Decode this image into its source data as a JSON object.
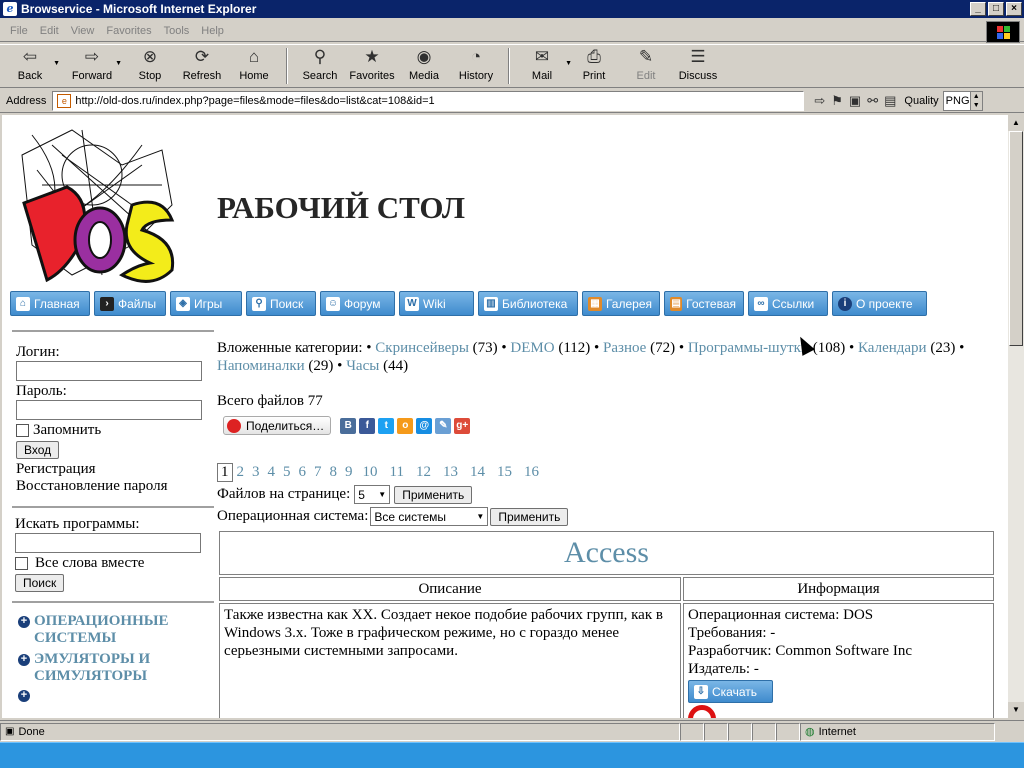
{
  "window": {
    "title": "Browservice - Microsoft Internet Explorer"
  },
  "menu": [
    "File",
    "Edit",
    "View",
    "Favorites",
    "Tools",
    "Help"
  ],
  "toolbar": {
    "back": "Back",
    "forward": "Forward",
    "stop": "Stop",
    "refresh": "Refresh",
    "home": "Home",
    "search": "Search",
    "favorites": "Favorites",
    "media": "Media",
    "history": "History",
    "mail": "Mail",
    "print": "Print",
    "edit": "Edit",
    "discuss": "Discuss"
  },
  "address": {
    "label": "Address",
    "url": "http://old-dos.ru/index.php?page=files&mode=files&do=list&cat=108&id=1",
    "quality_label": "Quality",
    "quality_value": "PNG"
  },
  "site": {
    "page_title": "РАБОЧИЙ СТОЛ"
  },
  "nav": [
    "Главная",
    "Файлы",
    "Игры",
    "Поиск",
    "Форум",
    "Wiki",
    "Библиотека",
    "Галерея",
    "Гостевая",
    "Ссылки",
    "О проекте"
  ],
  "login": {
    "login_label": "Логин:",
    "password_label": "Пароль:",
    "remember": "Запомнить",
    "enter": "Вход",
    "register": "Регистрация",
    "restore": "Восстановление пароля"
  },
  "search": {
    "label": "Искать программы:",
    "all_words": "Все слова вместе",
    "button": "Поиск"
  },
  "categories": [
    "ОПЕРАЦИОННЫЕ СИСТЕМЫ",
    "ЭМУЛЯТОРЫ И СИМУЛЯТОРЫ"
  ],
  "subcats": {
    "prefix": "Вложенные категории:",
    "items": [
      {
        "name": "Скринсейверы",
        "count": "(73)"
      },
      {
        "name": "DEMO",
        "count": "(112)"
      },
      {
        "name": "Разное",
        "count": "(72)"
      },
      {
        "name": "Программы-шутки",
        "count": "(108)"
      },
      {
        "name": "Календари",
        "count": "(23)"
      },
      {
        "name": "Напоминалки",
        "count": "(29)"
      },
      {
        "name": "Часы",
        "count": "(44)"
      }
    ]
  },
  "total": "Всего файлов 77",
  "share": {
    "label": "Поделиться…"
  },
  "pages": [
    "1",
    "2",
    "3",
    "4",
    "5",
    "6",
    "7",
    "8",
    "9",
    "10",
    "11",
    "12",
    "13",
    "14",
    "15",
    "16"
  ],
  "per_page": {
    "label": "Файлов на странице:",
    "value": "5",
    "apply": "Применить"
  },
  "os_filter": {
    "label": "Операционная система:",
    "value": "Все системы",
    "apply": "Применить"
  },
  "file": {
    "name": "Access",
    "col_desc": "Описание",
    "col_info": "Информация",
    "description": "Также известна как XX. Создает некое подобие рабочих групп, как в Windows 3.x. Тоже в графическом режиме, но с гораздо менее серьезными системными запросами.",
    "os": "Операционная система: DOS",
    "req": "Требования: -",
    "dev": "Разработчик: Common Software Inc",
    "pub": "Издатель: -",
    "download": "Скачать"
  },
  "status": {
    "text": "Done",
    "zone": "Internet"
  }
}
